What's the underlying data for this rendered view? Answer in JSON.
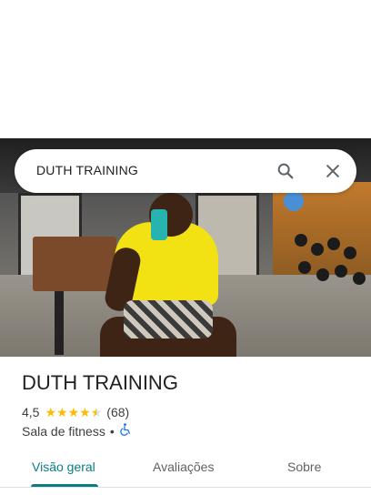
{
  "search": {
    "query": "DUTH TRAINING",
    "search_icon": "search-icon",
    "close_icon": "close-icon"
  },
  "place": {
    "name": "DUTH TRAINING",
    "rating": "4,5",
    "stars_filled": 4.5,
    "reviews_count": "(68)",
    "category": "Sala de fitness",
    "separator": "•",
    "accessibility_icon": "wheelchair-accessible-icon"
  },
  "tabs": [
    {
      "label": "Visão geral",
      "active": true
    },
    {
      "label": "Avaliações",
      "active": false
    },
    {
      "label": "Sobre",
      "active": false
    }
  ],
  "colors": {
    "accent": "#0b7c86",
    "star": "#fbbc04",
    "accessibility": "#1a73e8"
  }
}
